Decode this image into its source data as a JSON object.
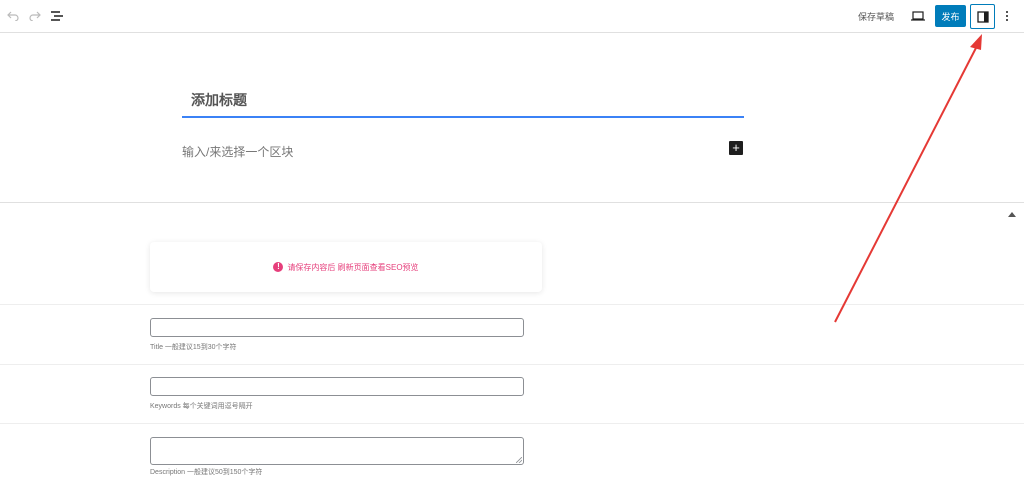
{
  "toolbar": {
    "undo_icon": "undo-icon",
    "redo_icon": "redo-icon",
    "outline_icon": "list-view-icon",
    "save_draft_label": "保存草稿",
    "preview_icon": "desktop-preview-icon",
    "publish_label": "发布",
    "settings_icon": "sidebar-toggle-icon",
    "more_icon": "vertical-ellipsis-icon"
  },
  "editor": {
    "title_placeholder": "添加标题",
    "block_placeholder": "输入/来选择一个区块",
    "add_block_symbol": "+"
  },
  "seo_panel": {
    "notice_icon_glyph": "!",
    "notice_text": "请保存内容后 刷新页面查看SEO预览",
    "notice_color": "#e63e7b",
    "fields": [
      {
        "hint": "Title 一般建议15到30个字符",
        "value": ""
      },
      {
        "hint": "Keywords 每个关键词用逗号隔开",
        "value": ""
      },
      {
        "hint": "Description 一般建议50到150个字符",
        "value": ""
      }
    ]
  },
  "colors": {
    "accent": "#007cba",
    "title_underline": "#3b82f6",
    "annotation_arrow": "#e53935"
  }
}
